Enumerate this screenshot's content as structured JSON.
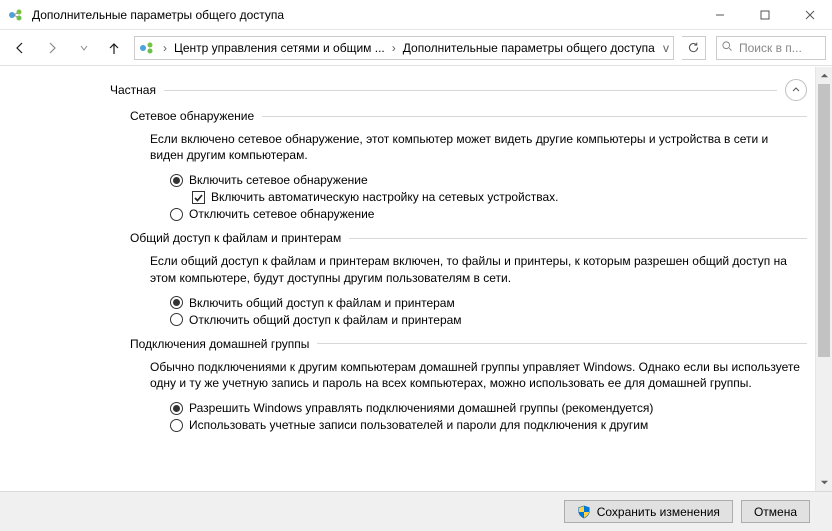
{
  "window": {
    "title": "Дополнительные параметры общего доступа"
  },
  "breadcrumb": {
    "item1": "Центр управления сетями и общим ...",
    "item2": "Дополнительные параметры общего доступа"
  },
  "search": {
    "placeholder": "Поиск в п..."
  },
  "profile": {
    "name": "Частная"
  },
  "sections": {
    "discovery": {
      "title": "Сетевое обнаружение",
      "desc": "Если включено сетевое обнаружение, этот компьютер может видеть другие компьютеры и устройства в сети и виден другим компьютерам.",
      "opt_on": "Включить сетевое обнаружение",
      "opt_auto": "Включить автоматическую настройку на сетевых устройствах.",
      "opt_off": "Отключить сетевое обнаружение"
    },
    "sharing": {
      "title": "Общий доступ к файлам и принтерам",
      "desc": "Если общий доступ к файлам и принтерам включен, то файлы и принтеры, к которым разрешен общий доступ на этом компьютере, будут доступны другим пользователям в сети.",
      "opt_on": "Включить общий доступ к файлам и принтерам",
      "opt_off": "Отключить общий доступ к файлам и принтерам"
    },
    "homegroup": {
      "title": "Подключения домашней группы",
      "desc": "Обычно подключениями к другим компьютерам домашней группы управляет Windows. Однако если вы используете одну и ту же учетную запись и пароль на всех компьютерах, можно использовать ее для домашней группы.",
      "opt_win": "Разрешить Windows управлять подключениями домашней группы (рекомендуется)",
      "opt_user": "Использовать учетные записи пользователей и пароли для подключения к другим"
    }
  },
  "footer": {
    "save": "Сохранить изменения",
    "cancel": "Отмена"
  }
}
